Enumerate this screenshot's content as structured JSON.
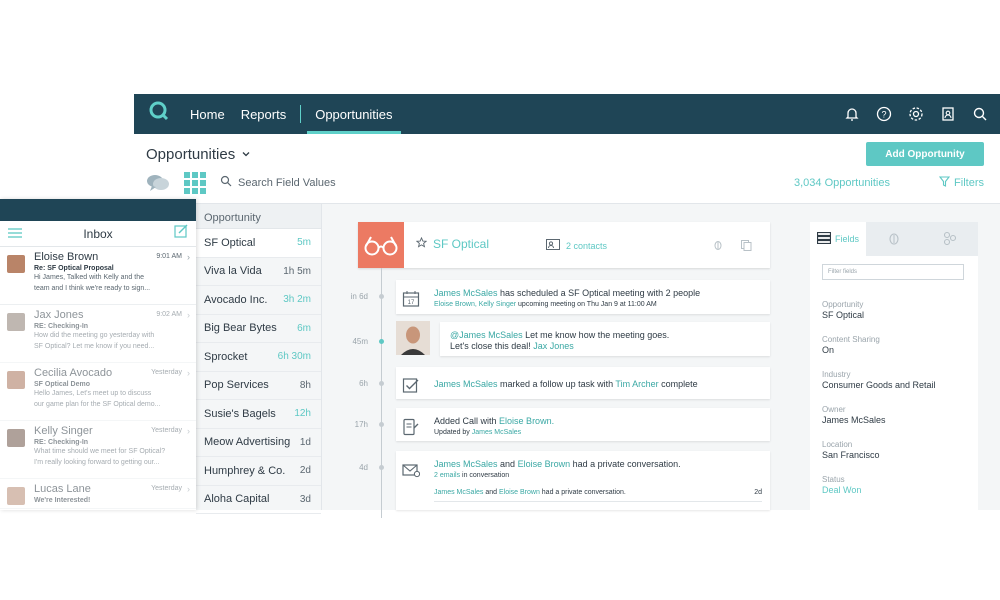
{
  "nav": {
    "home": "Home",
    "reports": "Reports",
    "opportunities": "Opportunities"
  },
  "header": {
    "title": "Opportunities",
    "add_button": "Add Opportunity",
    "search_placeholder": "Search Field Values",
    "count": "3,034 Opportunities",
    "filters": "Filters"
  },
  "inbox": {
    "title": "Inbox",
    "messages": [
      {
        "name": "Eloise Brown",
        "time": "9:01 AM",
        "subject": "Re: SF Optical Proposal",
        "snippet1": "Hi James, Talked with Kelly and the",
        "snippet2": "team and I think we're ready to sign..."
      },
      {
        "name": "Jax Jones",
        "time": "9:02 AM",
        "subject": "RE: Checking-In",
        "snippet1": "How did the meeting go yesterday with",
        "snippet2": "SF Optical? Let me know if you need..."
      },
      {
        "name": "Cecilia Avocado",
        "time": "Yesterday",
        "subject": "SF Optical Demo",
        "snippet1": "Hello James, Let's meet up to discuss",
        "snippet2": "our game plan for the SF Optical demo..."
      },
      {
        "name": "Kelly Singer",
        "time": "Yesterday",
        "subject": "RE: Checking-In",
        "snippet1": "What time should we meet for SF Optical?",
        "snippet2": "I'm really looking forward to getting our..."
      },
      {
        "name": "Lucas Lane",
        "time": "Yesterday",
        "subject": "We're Interested!",
        "snippet1": "",
        "snippet2": ""
      }
    ]
  },
  "opportunity_list": {
    "header": "Opportunity",
    "rows": [
      {
        "name": "SF Optical",
        "time": "5m"
      },
      {
        "name": "Viva la Vida",
        "time": "1h 5m"
      },
      {
        "name": "Avocado Inc.",
        "time": "3h 2m"
      },
      {
        "name": "Big Bear Bytes",
        "time": "6m"
      },
      {
        "name": "Sprocket",
        "time": "6h 30m"
      },
      {
        "name": "Pop Services",
        "time": "8h"
      },
      {
        "name": "Susie's Bagels",
        "time": "12h"
      },
      {
        "name": "Meow Advertising",
        "time": "1d"
      },
      {
        "name": "Humphrey & Co.",
        "time": "2d"
      },
      {
        "name": "Aloha Capital",
        "time": "3d"
      }
    ]
  },
  "opportunity": {
    "name": "SF Optical",
    "contacts": "2 contacts"
  },
  "timeline": {
    "labels": [
      "in 6d",
      "45m",
      "6h",
      "17h",
      "4d"
    ],
    "a1_user": "James McSales",
    "a1_text": " has scheduled a SF Optical meeting with 2 people",
    "a1_sub_names": "Eloise Brown, Kelly Singer",
    "a1_sub_text": " upcoming meeting on Thu Jan 9 at 11:00 AM",
    "a2_mention": "@James McSales",
    "a2_text1": " Let me know how the meeting goes.",
    "a2_text2": "Let's close this deal! ",
    "a2_author": "Jax Jones",
    "a3_user": "James McSales",
    "a3_text": " marked a follow up task with ",
    "a3_target": "Tim Archer",
    "a3_end": " complete",
    "a4_text": "Added Call with ",
    "a4_target": "Eloise Brown.",
    "a4_sub": "Updated by ",
    "a4_sub_user": "James McSales",
    "a5_user1": "James McSales",
    "a5_and": " and ",
    "a5_user2": "Eloise Brown",
    "a5_text": " had a private conversation.",
    "a5_emails": "2 emails",
    "a5_emails_text": " in conversation",
    "a5_row_user1": "James McSales",
    "a5_row_and": " and ",
    "a5_row_user2": "Eloise Brown",
    "a5_row_text": " had a private conversation.",
    "a5_row_time": "2d"
  },
  "fields_panel": {
    "tab": "Fields",
    "filter_placeholder": "Filter fields",
    "fields": [
      {
        "key": "Opportunity",
        "value": "SF Optical"
      },
      {
        "key": "Content Sharing",
        "value": "On"
      },
      {
        "key": "Industry",
        "value": "Consumer Goods and Retail"
      },
      {
        "key": "Owner",
        "value": "James McSales"
      },
      {
        "key": "Location",
        "value": "San Francisco"
      },
      {
        "key": "Status",
        "value": "Deal Won"
      }
    ]
  },
  "colors": {
    "nav_bg": "#1f4556",
    "accent": "#5ec8c4",
    "badge": "#ec7a63"
  }
}
